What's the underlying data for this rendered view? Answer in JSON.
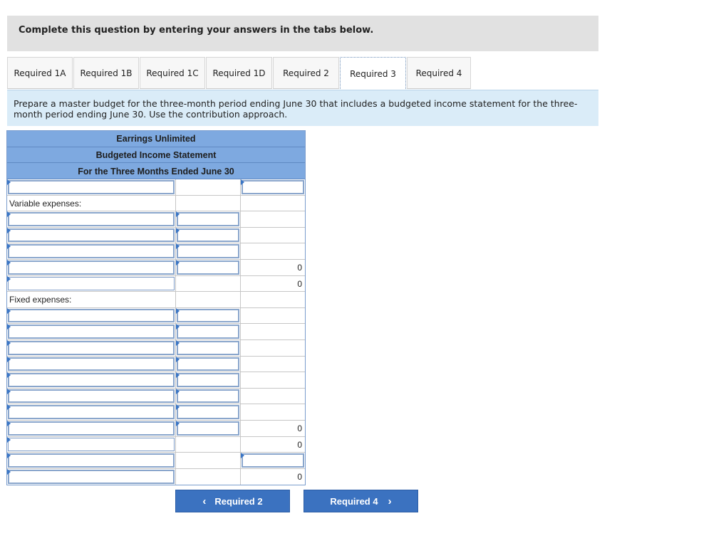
{
  "instructions": "Complete this question by entering your answers in the tabs below.",
  "tabs": [
    {
      "label": "Required 1A",
      "active": false
    },
    {
      "label": "Required 1B",
      "active": false
    },
    {
      "label": "Required 1C",
      "active": false
    },
    {
      "label": "Required 1D",
      "active": false
    },
    {
      "label": "Required 2",
      "active": false
    },
    {
      "label": "Required 3",
      "active": true
    },
    {
      "label": "Required 4",
      "active": false
    }
  ],
  "prompt": "Prepare a master budget for the three-month period ending June 30 that includes a budgeted income statement for the three-month period ending June 30. Use the contribution approach.",
  "statement": {
    "company": "Earrings Unlimited",
    "title": "Budgeted Income Statement",
    "period": "For the Three Months Ended June 30",
    "variable_label": "Variable expenses:",
    "fixed_label": "Fixed expenses:",
    "total_variable_1": "0",
    "total_variable_2": "0",
    "total_fixed_1": "0",
    "total_fixed_2": "0",
    "net_total": "0"
  },
  "nav": {
    "prev_label": "Required 2",
    "next_label": "Required 4",
    "prev_icon": "chevron-left-icon",
    "next_icon": "chevron-right-icon"
  },
  "colors": {
    "header_bg": "#7ea9e0",
    "button_bg": "#3b72c0",
    "prompt_bg": "#daecf8",
    "instructions_bg": "#e1e1e1"
  }
}
